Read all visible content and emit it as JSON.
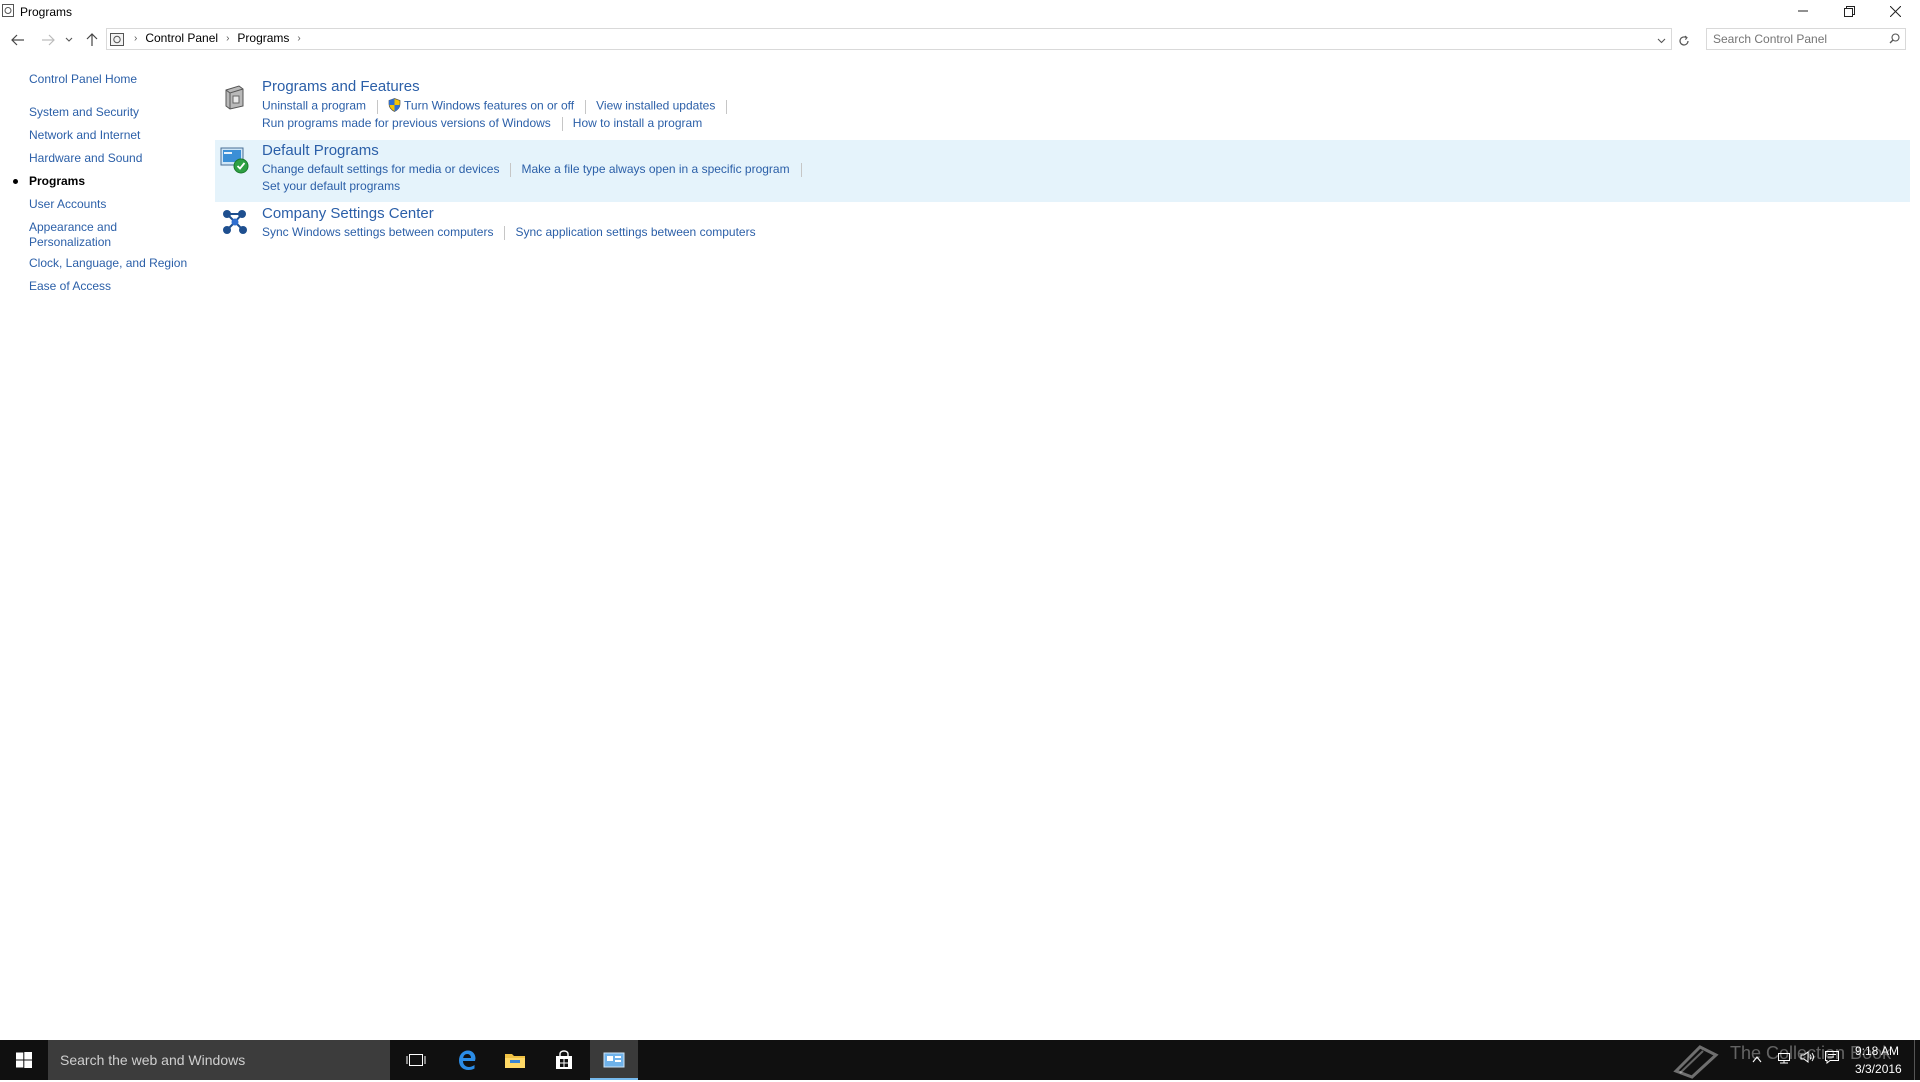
{
  "window": {
    "title": "Programs"
  },
  "address": {
    "crumbs": [
      "Control Panel",
      "Programs"
    ],
    "search_placeholder": "Search Control Panel"
  },
  "left_nav": {
    "home": "Control Panel Home",
    "items": [
      "System and Security",
      "Network and Internet",
      "Hardware and Sound",
      "Programs",
      "User Accounts",
      "Appearance and",
      "Personalization",
      "Clock, Language, and Region",
      "Ease of Access"
    ],
    "current": "Programs"
  },
  "categories": {
    "programs_features": {
      "title": "Programs and Features",
      "links": [
        "Uninstall a program",
        "Turn Windows features on or off",
        "View installed updates",
        "Run programs made for previous versions of Windows",
        "How to install a program"
      ]
    },
    "default_programs": {
      "title": "Default Programs",
      "links": [
        "Change default settings for media or devices",
        "Make a file type always open in a specific program",
        "Set your default programs"
      ]
    },
    "company_settings": {
      "title": "Company Settings Center",
      "links": [
        "Sync Windows settings between computers",
        "Sync application settings between computers"
      ]
    }
  },
  "taskbar": {
    "search_text": "Search the web and Windows",
    "time": "9:18 AM",
    "date": "3/3/2016",
    "watermark": "The Collection Book"
  },
  "colors": {
    "link": "#2b5fa8",
    "category_title": "#1e7a1e",
    "highlight": "#e5f3fb",
    "taskbar": "#101010"
  }
}
